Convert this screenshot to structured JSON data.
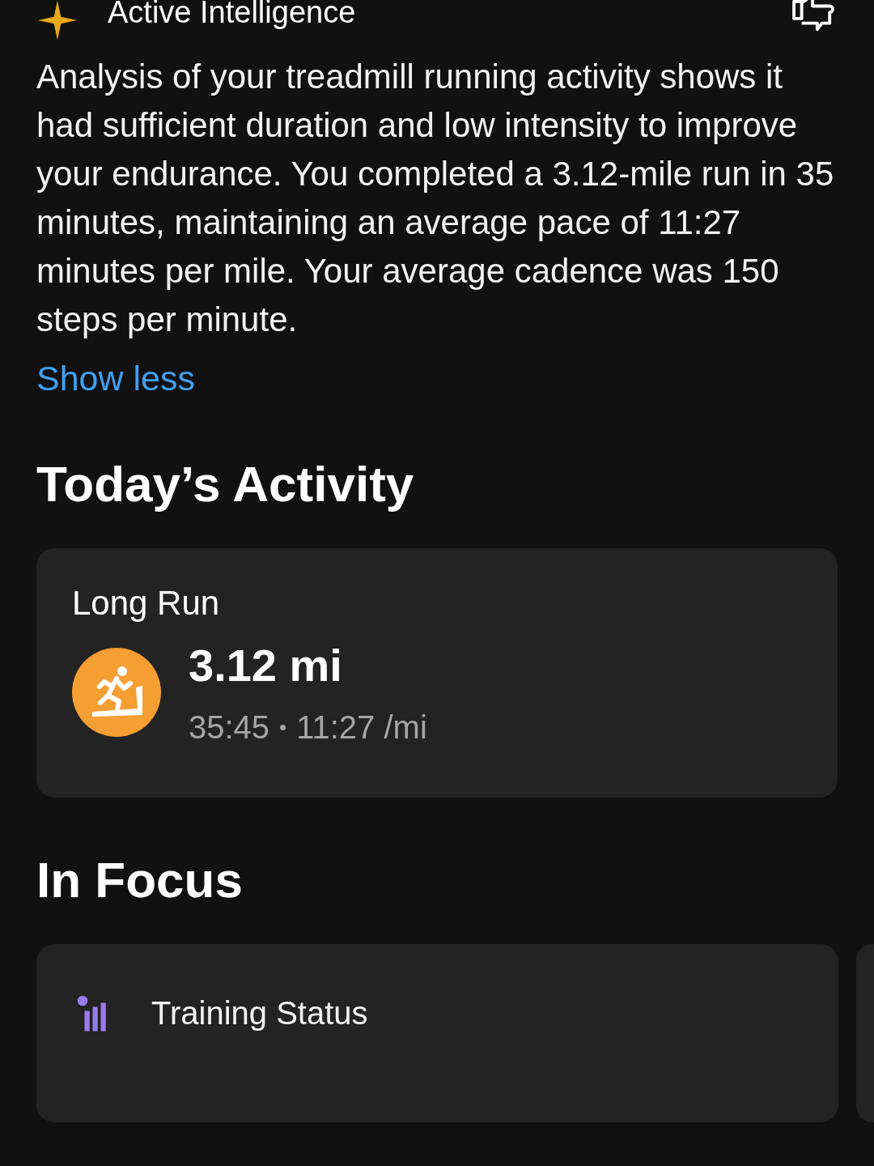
{
  "header": {
    "title": "Active Intelligence"
  },
  "summary": {
    "text": "Analysis of your treadmill running activity shows it had sufficient duration and low intensity to improve your endurance. You completed a 3.12-mile run in 35 minutes, maintaining an average pace of 11:27 minutes per mile. Your average cadence was 150 steps per minute.",
    "toggle": "Show less"
  },
  "today": {
    "heading": "Today’s Activity",
    "activity": {
      "name": "Long Run",
      "distance": "3.12 mi",
      "duration": "35:45",
      "separator": "•",
      "pace": "11:27 /mi"
    }
  },
  "focus": {
    "heading": "In Focus",
    "cards": [
      {
        "title": "Training Status"
      }
    ]
  }
}
